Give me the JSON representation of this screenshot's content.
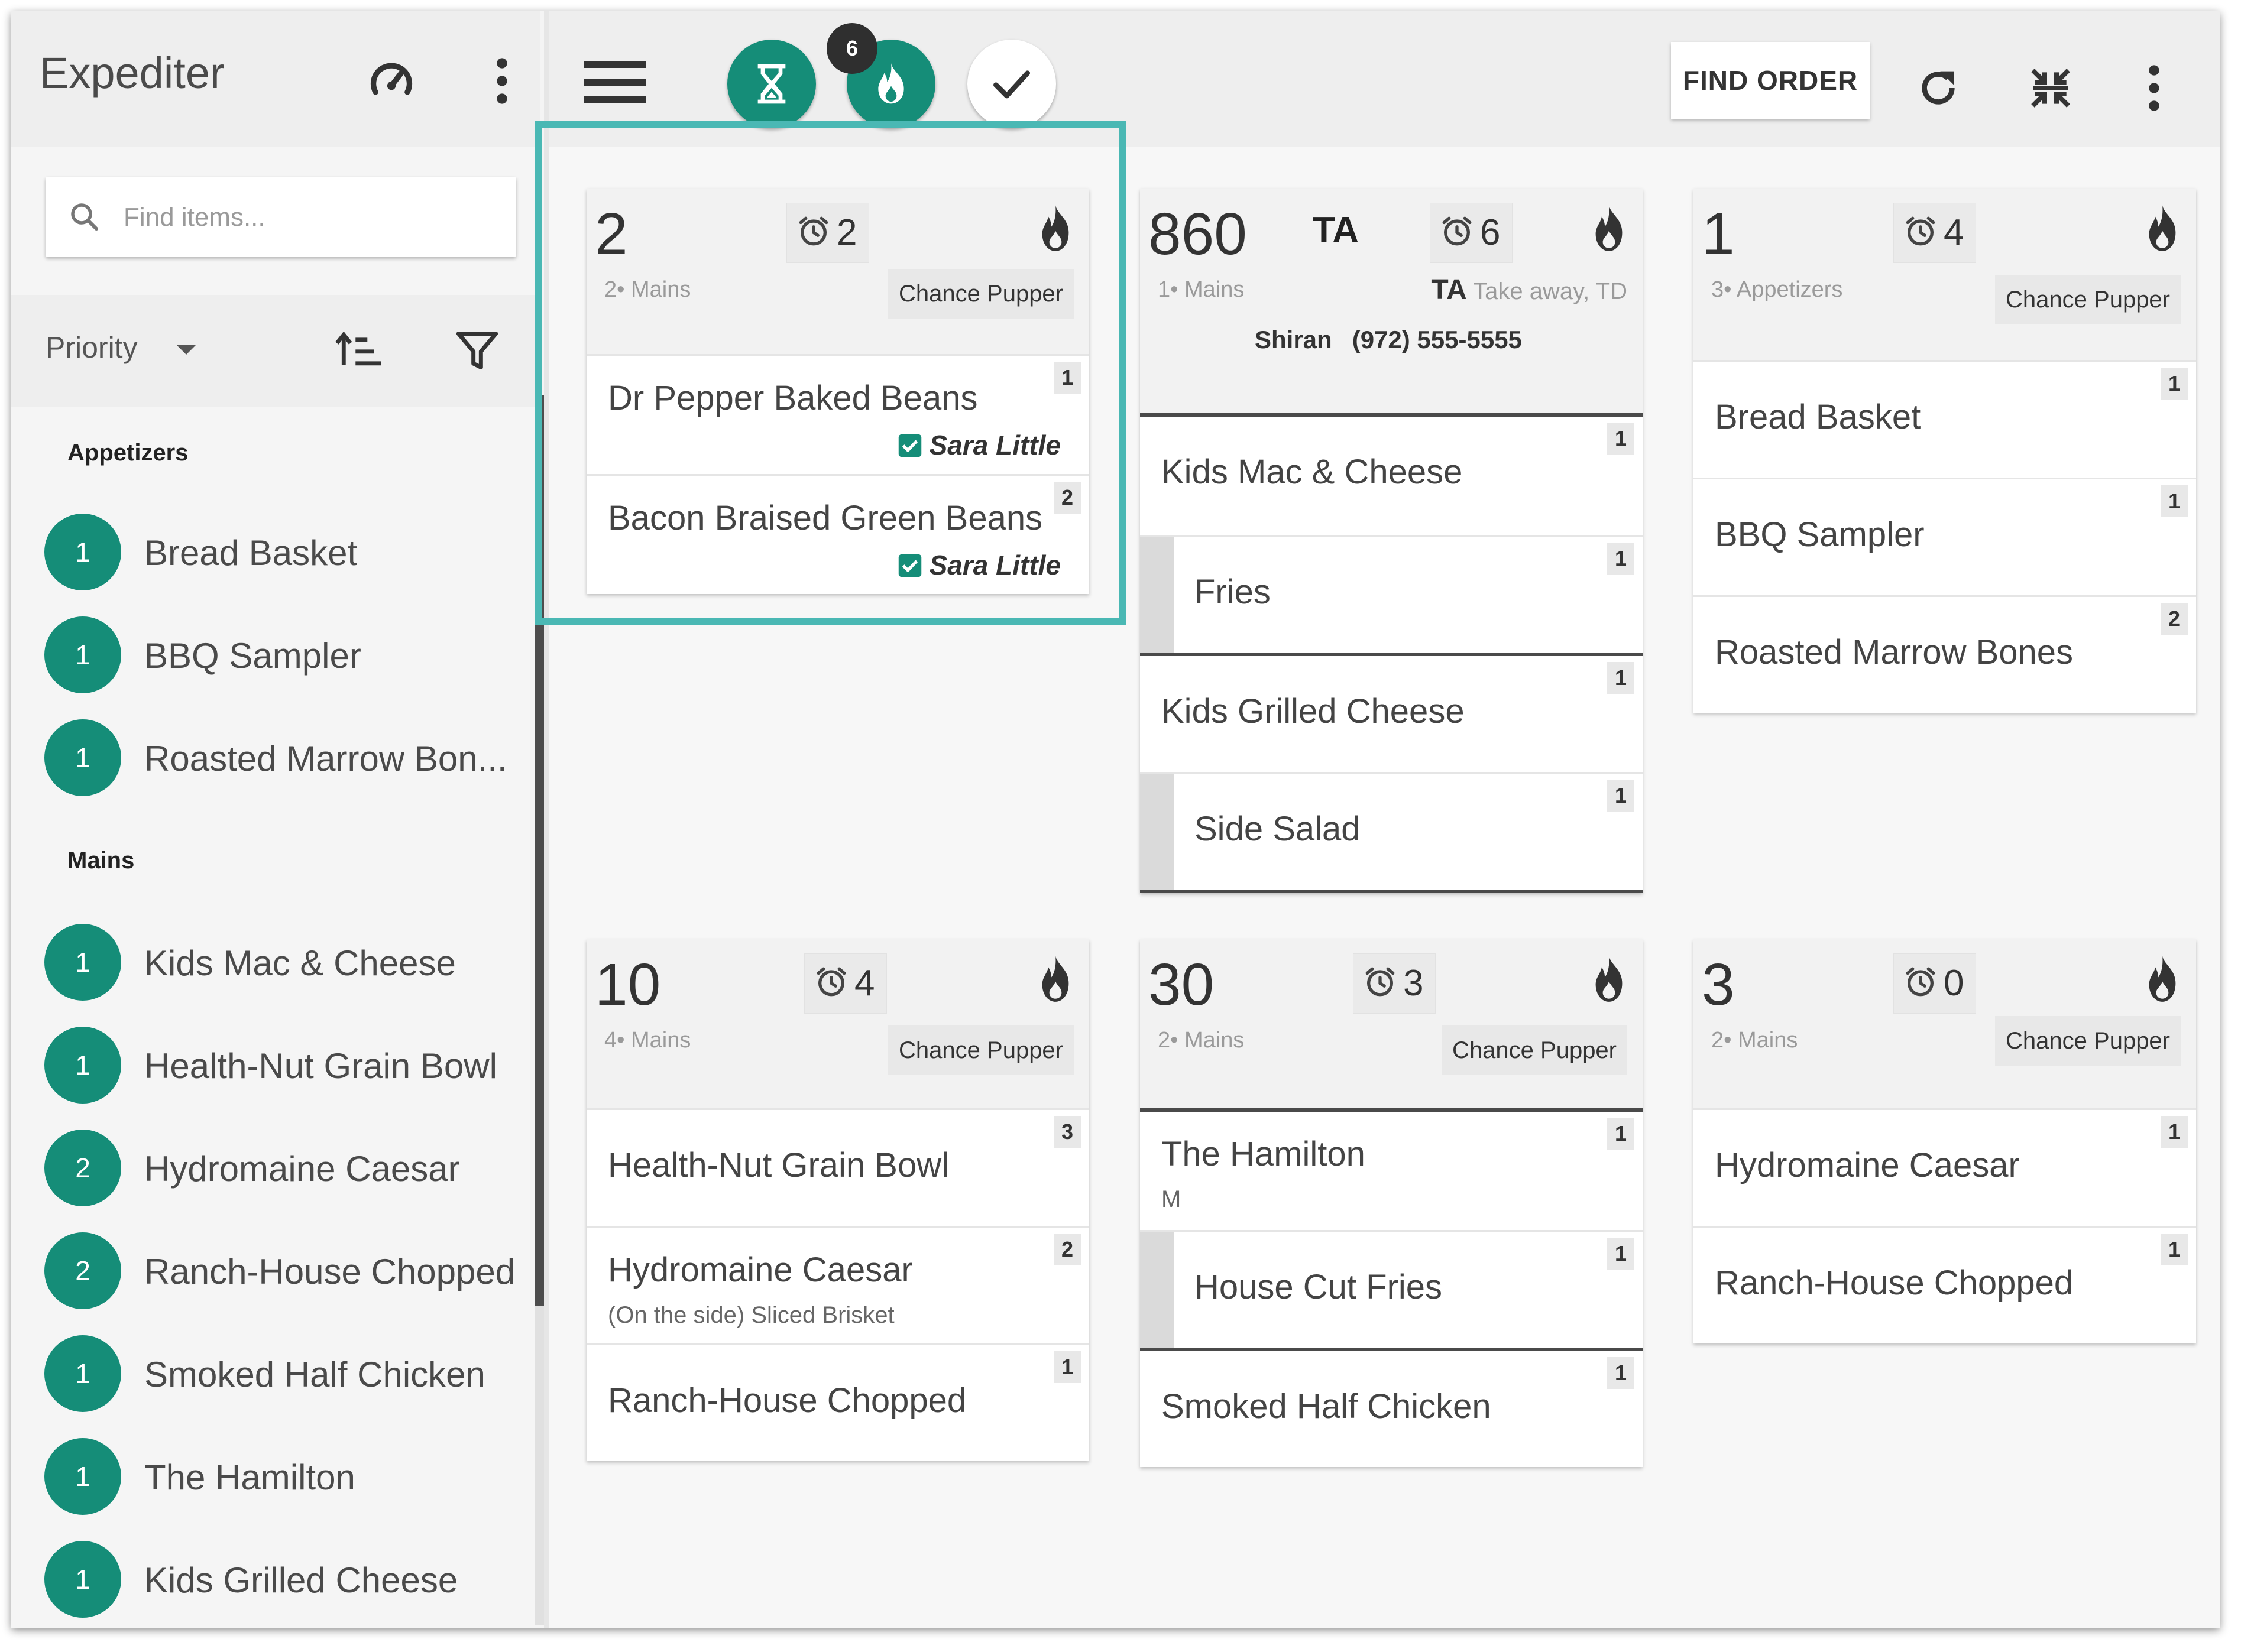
{
  "sidebar": {
    "title": "Expediter",
    "search_placeholder": "Find items...",
    "sort_label": "Priority",
    "sections": [
      {
        "title": "Appetizers",
        "items": [
          {
            "count": "1",
            "name": "Bread Basket"
          },
          {
            "count": "1",
            "name": "BBQ Sampler"
          },
          {
            "count": "1",
            "name": "Roasted Marrow Bon..."
          }
        ]
      },
      {
        "title": "Mains",
        "items": [
          {
            "count": "1",
            "name": "Kids Mac & Cheese"
          },
          {
            "count": "1",
            "name": "Health-Nut Grain Bowl"
          },
          {
            "count": "2",
            "name": "Hydromaine Caesar"
          },
          {
            "count": "2",
            "name": "Ranch-House Chopped"
          },
          {
            "count": "1",
            "name": "Smoked Half Chicken"
          },
          {
            "count": "1",
            "name": "The Hamilton"
          },
          {
            "count": "1",
            "name": "Kids Grilled Cheese"
          }
        ]
      }
    ]
  },
  "topbar": {
    "fire_count": "6",
    "find_order_label": "FIND ORDER"
  },
  "colors": {
    "accent": "#158d78",
    "highlight": "#4ab8b4"
  },
  "cards": [
    {
      "number": "2",
      "timer": "2",
      "course": "2• Mains",
      "owner": "Chance Pupper",
      "items": [
        {
          "name": "Dr Pepper Baked Beans",
          "qty": "1",
          "assignee": "Sara Little"
        },
        {
          "name": "Bacon Braised Green Beans",
          "qty": "2",
          "assignee": "Sara Little"
        }
      ]
    },
    {
      "number": "860",
      "tag": "TA",
      "timer": "6",
      "course": "1• Mains",
      "ta_code": "TA",
      "ta_desc": "Take away, TD",
      "customer_name": "Shiran",
      "customer_phone": "(972) 555-5555",
      "items": [
        {
          "name": "Kids Mac & Cheese",
          "qty": "1"
        },
        {
          "name": "Fries",
          "qty": "1"
        },
        {
          "name": "Kids Grilled Cheese",
          "qty": "1"
        },
        {
          "name": "Side Salad",
          "qty": "1"
        }
      ]
    },
    {
      "number": "1",
      "timer": "4",
      "course": "3• Appetizers",
      "owner": "Chance Pupper",
      "items": [
        {
          "name": "Bread Basket",
          "qty": "1"
        },
        {
          "name": "BBQ Sampler",
          "qty": "1"
        },
        {
          "name": "Roasted Marrow Bones",
          "qty": "2"
        }
      ]
    },
    {
      "number": "10",
      "timer": "4",
      "course": "4• Mains",
      "owner": "Chance Pupper",
      "items": [
        {
          "name": "Health-Nut Grain Bowl",
          "qty": "3"
        },
        {
          "name": "Hydromaine Caesar",
          "qty": "2",
          "note": "(On the side) Sliced Brisket"
        },
        {
          "name": "Ranch-House Chopped",
          "qty": "1"
        }
      ]
    },
    {
      "number": "30",
      "timer": "3",
      "course": "2• Mains",
      "owner": "Chance Pupper",
      "items": [
        {
          "name": "The Hamilton",
          "qty": "1",
          "note": "M"
        },
        {
          "name": "House Cut Fries",
          "qty": "1"
        },
        {
          "name": "Smoked Half Chicken",
          "qty": "1"
        }
      ]
    },
    {
      "number": "3",
      "timer": "0",
      "course": "2• Mains",
      "owner": "Chance Pupper",
      "items": [
        {
          "name": "Hydromaine Caesar",
          "qty": "1"
        },
        {
          "name": "Ranch-House Chopped",
          "qty": "1"
        }
      ]
    }
  ]
}
